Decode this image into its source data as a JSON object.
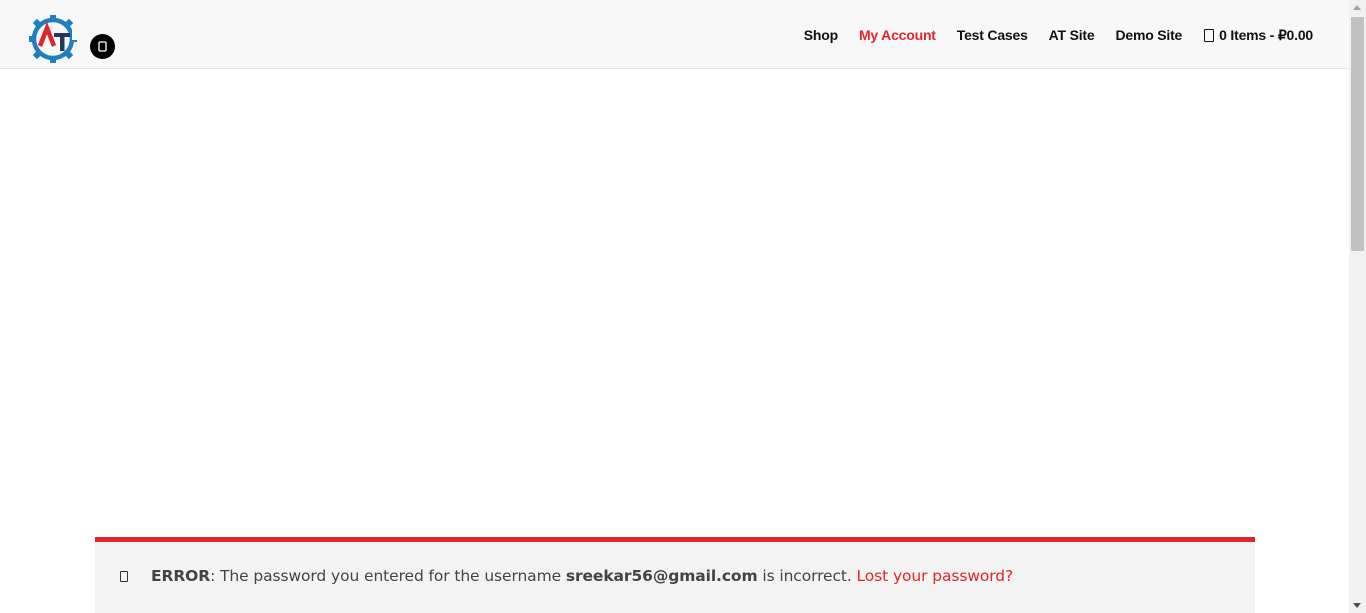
{
  "nav": {
    "items": [
      {
        "label": "Shop",
        "active": false
      },
      {
        "label": "My Account",
        "active": true
      },
      {
        "label": "Test Cases",
        "active": false
      },
      {
        "label": "AT Site",
        "active": false
      },
      {
        "label": "Demo Site",
        "active": false
      }
    ],
    "cart": {
      "label": "0 Items - ₽0.00",
      "icon": "cart-icon"
    }
  },
  "header": {
    "logo_icon": "gear-logo-icon",
    "theme_toggle_icon": "theme-toggle-icon"
  },
  "notice": {
    "icon": "warning-icon",
    "error_label": "ERROR",
    "message_prefix": ": The password you entered for the username ",
    "username": "sreekar56@gmail.com",
    "message_suffix": " is incorrect. ",
    "link_label": "Lost your password?"
  },
  "colors": {
    "accent": "#e0262d",
    "header_bg": "#f8f8f8",
    "logo_blue": "#1f7fc0",
    "logo_dark": "#1f3a5a"
  }
}
